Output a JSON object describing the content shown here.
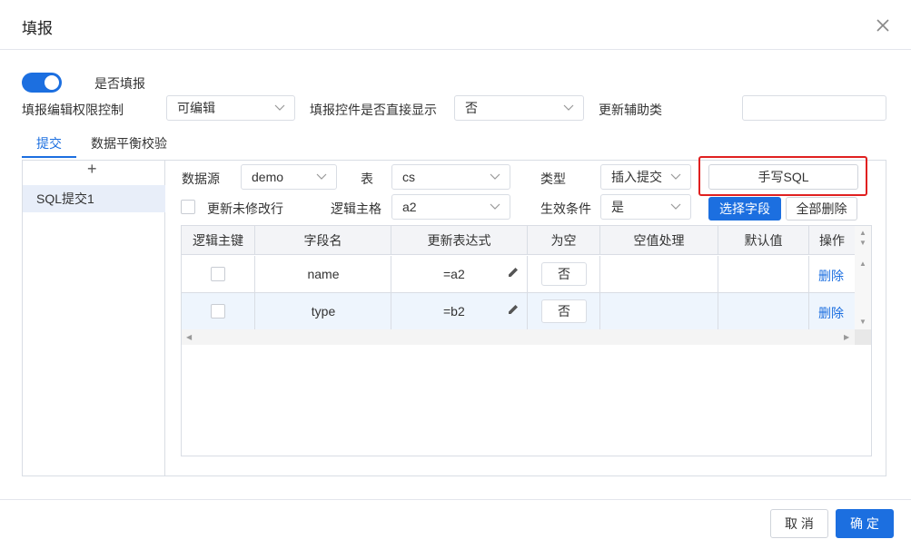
{
  "dialog": {
    "title": "填报"
  },
  "colors": {
    "accent": "#1c6fe0",
    "highlight": "#e02020"
  },
  "fill_enabled": {
    "label": "是否填报",
    "on": true
  },
  "permission": {
    "label": "填报编辑权限控制",
    "value": "可编辑"
  },
  "direct_display": {
    "label": "填报控件是否直接显示",
    "value": "否"
  },
  "aux_class": {
    "label": "更新辅助类",
    "value": ""
  },
  "tabs": [
    {
      "label": "提交",
      "active": true
    },
    {
      "label": "数据平衡校验",
      "active": false
    }
  ],
  "submit_list": {
    "add_symbol": "+",
    "items": [
      "SQL提交1"
    ]
  },
  "form": {
    "datasource_label": "数据源",
    "datasource_value": "demo",
    "table_label": "表",
    "table_value": "cs",
    "type_label": "类型",
    "type_value": "插入提交",
    "manual_sql_label": "手写SQL",
    "update_unmodified_label": "更新未修改行",
    "logic_pk_label": "逻辑主格",
    "logic_pk_value": "a2",
    "effect_label": "生效条件",
    "effect_value": "是",
    "select_fields_label": "选择字段",
    "delete_all_label": "全部删除"
  },
  "table": {
    "columns": [
      "逻辑主键",
      "字段名",
      "更新表达式",
      "为空",
      "空值处理",
      "默认值",
      "操作"
    ],
    "rows": [
      {
        "field": "name",
        "expr": "=a2",
        "null": "否",
        "action": "删除"
      },
      {
        "field": "type",
        "expr": "=b2",
        "null": "否",
        "action": "删除"
      }
    ]
  },
  "footer": {
    "cancel_label": "取 消",
    "ok_label": "确 定"
  }
}
